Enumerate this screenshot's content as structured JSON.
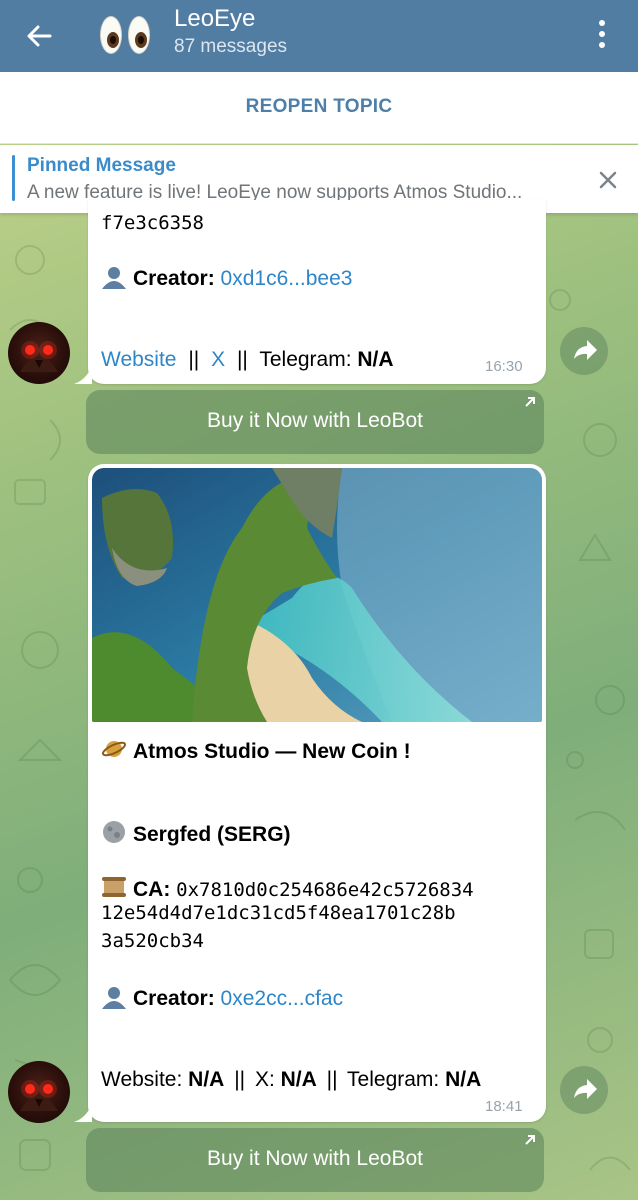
{
  "header": {
    "title": "LeoEye",
    "subtitle": "87 messages"
  },
  "topic_bar": {
    "reopen_label": "REOPEN TOPIC"
  },
  "pinned": {
    "title": "Pinned Message",
    "text": "A new feature is live!  LeoEye now supports Atmos Studio..."
  },
  "message1": {
    "ca_tail": "f7e3c6358",
    "creator_label": "Creator:",
    "creator_value": "0xd1c6...bee3",
    "website_label": "Website",
    "sep1": "||",
    "x_label": "X",
    "sep2": "||",
    "telegram_label": "Telegram:",
    "telegram_value": "N/A",
    "time": "16:30",
    "button_label": "Buy it Now with LeoBot"
  },
  "message2": {
    "title": "Atmos Studio — New Coin !",
    "coin": "Sergfed (SERG)",
    "ca_label": "CA:",
    "ca_line1": "0x7810d0c254686e42c5726834",
    "ca_line2": "12e54d4d7e1dc31cd5f48ea1701c28b",
    "ca_line3": "3a520cb34",
    "creator_label": "Creator:",
    "creator_value": "0xe2cc...cfac",
    "website_label": "Website:",
    "website_value": "N/A",
    "sep1": "||",
    "x_label": "X:",
    "x_value": "N/A",
    "sep2": "||",
    "telegram_label": "Telegram:",
    "telegram_value": "N/A",
    "time": "18:41",
    "button_label": "Buy it Now with LeoBot"
  },
  "icons": {
    "back": "arrow-left-icon",
    "menu": "more-vertical-icon",
    "close": "close-icon",
    "share": "share-icon",
    "external": "external-link-icon",
    "planet": "ringed-planet-icon",
    "coin": "moon-icon",
    "scroll": "scroll-icon",
    "person": "person-silhouette-icon"
  },
  "colors": {
    "header": "#517da2",
    "link": "#2e86c7",
    "accent": "#3a8bc9"
  }
}
